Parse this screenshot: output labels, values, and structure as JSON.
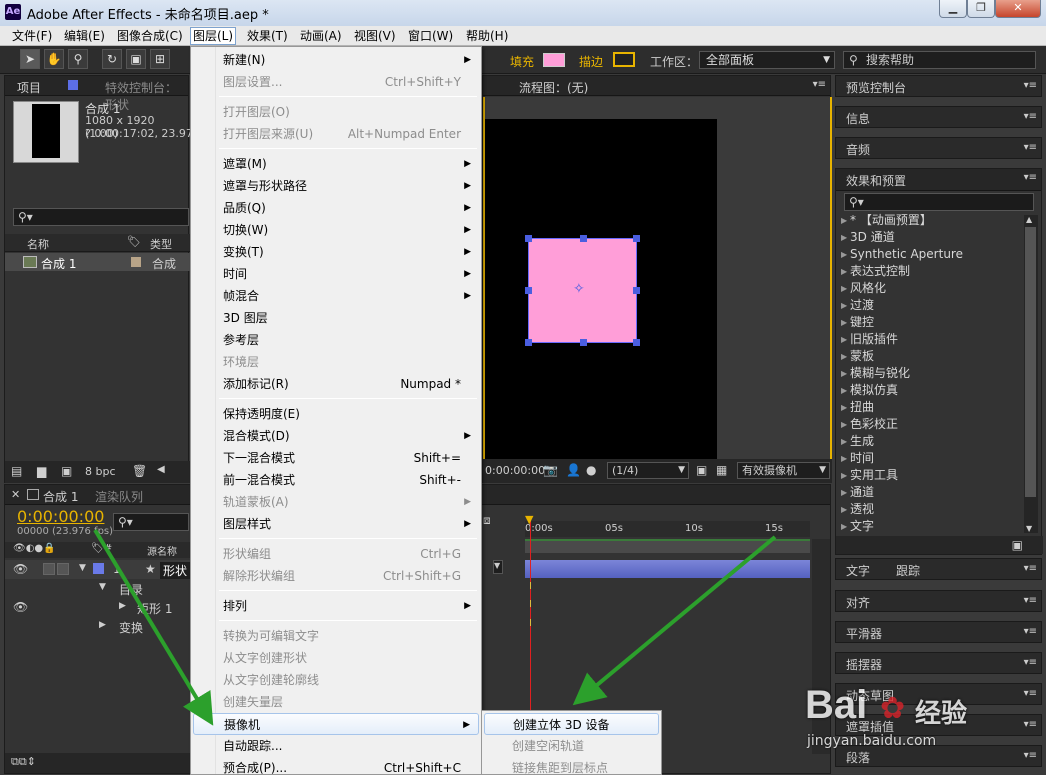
{
  "app": {
    "title": "Adobe After Effects - 未命名项目.aep *",
    "icon_label": "Ae"
  },
  "window_buttons": [
    "minimize-icon",
    "restore-icon",
    "close-icon"
  ],
  "menubar": [
    "文件(F)",
    "编辑(E)",
    "图像合成(C)",
    "图层(L)",
    "效果(T)",
    "动画(A)",
    "视图(V)",
    "窗口(W)",
    "帮助(H)"
  ],
  "toolbar": {
    "fill_label": "填充",
    "stroke_label": "描边",
    "workspace_label": "工作区：",
    "workspace_value": "全部面板",
    "search_placeholder": "搜索帮助",
    "fill_color": "#ff9ed8"
  },
  "project_panel": {
    "tab": "项目",
    "effects_tab": "特效控制台：形状",
    "comp_name": "合成 1",
    "comp_dims": "1080 x 1920 (1.00)",
    "comp_duration": "? 0:00:17:02, 23.976",
    "col_name": "名称",
    "col_type": "类型",
    "item_name": "合成 1",
    "item_type": "合成",
    "bpc": "8 bpc"
  },
  "viewer": {
    "flow_tab": "流程图：(无)",
    "timecode": "0:00:00:00",
    "resolution": "(1/4)",
    "camera": "有效摄像机",
    "shape_color": "#ff9ed8"
  },
  "right_panels": {
    "preview": "预览控制台",
    "info": "信息",
    "audio": "音频",
    "effects": "效果和预置",
    "effects_list": [
      "* 【动画预置】",
      "3D 通道",
      "Synthetic Aperture",
      "表达式控制",
      "风格化",
      "过渡",
      "键控",
      "旧版插件",
      "蒙板",
      "模糊与锐化",
      "模拟仿真",
      "扭曲",
      "色彩校正",
      "生成",
      "时间",
      "实用工具",
      "通道",
      "透视",
      "文字"
    ],
    "lower": [
      "文字",
      "跟踪",
      "对齐",
      "平滑器",
      "摇摆器",
      "动态草图",
      "遮罩插值",
      "段落"
    ]
  },
  "timeline": {
    "tab": "合成 1",
    "render_tab": "渲染队列",
    "timecode": "0:00:00:00",
    "fps": "00000 (23.976 fps)",
    "col_source": "源名称",
    "layer_num": "1",
    "layer_name": "形状",
    "contents": "目录",
    "rect": "矩形 1",
    "transform": "变换",
    "ruler": [
      "0:00s",
      "05s",
      "10s",
      "15s"
    ]
  },
  "layer_menu": [
    {
      "label": "新建(N)",
      "shortcut": "",
      "arrow": true,
      "disabled": false
    },
    {
      "label": "图层设置...",
      "shortcut": "Ctrl+Shift+Y",
      "arrow": false,
      "disabled": true
    },
    {
      "sep": true
    },
    {
      "label": "打开图层(O)",
      "shortcut": "",
      "arrow": false,
      "disabled": true
    },
    {
      "label": "打开图层来源(U)",
      "shortcut": "Alt+Numpad Enter",
      "arrow": false,
      "disabled": true
    },
    {
      "sep": true
    },
    {
      "label": "遮罩(M)",
      "shortcut": "",
      "arrow": true,
      "disabled": false
    },
    {
      "label": "遮罩与形状路径",
      "shortcut": "",
      "arrow": true,
      "disabled": false
    },
    {
      "label": "品质(Q)",
      "shortcut": "",
      "arrow": true,
      "disabled": false
    },
    {
      "label": "切换(W)",
      "shortcut": "",
      "arrow": true,
      "disabled": false
    },
    {
      "label": "变换(T)",
      "shortcut": "",
      "arrow": true,
      "disabled": false
    },
    {
      "label": "时间",
      "shortcut": "",
      "arrow": true,
      "disabled": false
    },
    {
      "label": "帧混合",
      "shortcut": "",
      "arrow": true,
      "disabled": false
    },
    {
      "label": "3D 图层",
      "shortcut": "",
      "arrow": false,
      "disabled": false
    },
    {
      "label": "参考层",
      "shortcut": "",
      "arrow": false,
      "disabled": false
    },
    {
      "label": "环境层",
      "shortcut": "",
      "arrow": false,
      "disabled": true
    },
    {
      "label": "添加标记(R)",
      "shortcut": "Numpad *",
      "arrow": false,
      "disabled": false
    },
    {
      "sep": true
    },
    {
      "label": "保持透明度(E)",
      "shortcut": "",
      "arrow": false,
      "disabled": false
    },
    {
      "label": "混合模式(D)",
      "shortcut": "",
      "arrow": true,
      "disabled": false
    },
    {
      "label": "下一混合模式",
      "shortcut": "Shift+=",
      "arrow": false,
      "disabled": false
    },
    {
      "label": "前一混合模式",
      "shortcut": "Shift+-",
      "arrow": false,
      "disabled": false
    },
    {
      "label": "轨道蒙板(A)",
      "shortcut": "",
      "arrow": true,
      "disabled": true
    },
    {
      "label": "图层样式",
      "shortcut": "",
      "arrow": true,
      "disabled": false
    },
    {
      "sep": true
    },
    {
      "label": "形状编组",
      "shortcut": "Ctrl+G",
      "arrow": false,
      "disabled": true
    },
    {
      "label": "解除形状编组",
      "shortcut": "Ctrl+Shift+G",
      "arrow": false,
      "disabled": true
    },
    {
      "sep": true
    },
    {
      "label": "排列",
      "shortcut": "",
      "arrow": true,
      "disabled": false
    },
    {
      "sep": true
    },
    {
      "label": "转换为可编辑文字",
      "shortcut": "",
      "arrow": false,
      "disabled": true
    },
    {
      "label": "从文字创建形状",
      "shortcut": "",
      "arrow": false,
      "disabled": true
    },
    {
      "label": "从文字创建轮廓线",
      "shortcut": "",
      "arrow": false,
      "disabled": true
    },
    {
      "label": "创建矢量层",
      "shortcut": "",
      "arrow": false,
      "disabled": true
    },
    {
      "label": "摄像机",
      "shortcut": "",
      "arrow": true,
      "disabled": false,
      "highlight": true
    },
    {
      "label": "自动跟踪...",
      "shortcut": "",
      "arrow": false,
      "disabled": false
    },
    {
      "label": "预合成(P)...",
      "shortcut": "Ctrl+Shift+C",
      "arrow": false,
      "disabled": false
    }
  ],
  "camera_submenu": [
    {
      "label": "创建立体 3D 设备",
      "disabled": false,
      "highlight": true
    },
    {
      "label": "创建空闲轨道",
      "disabled": true
    },
    {
      "label": "链接焦距到层标点",
      "disabled": true
    }
  ],
  "watermark": {
    "brand": "Bai",
    "brand2": "经验",
    "url": "jingyan.baidu.com"
  }
}
